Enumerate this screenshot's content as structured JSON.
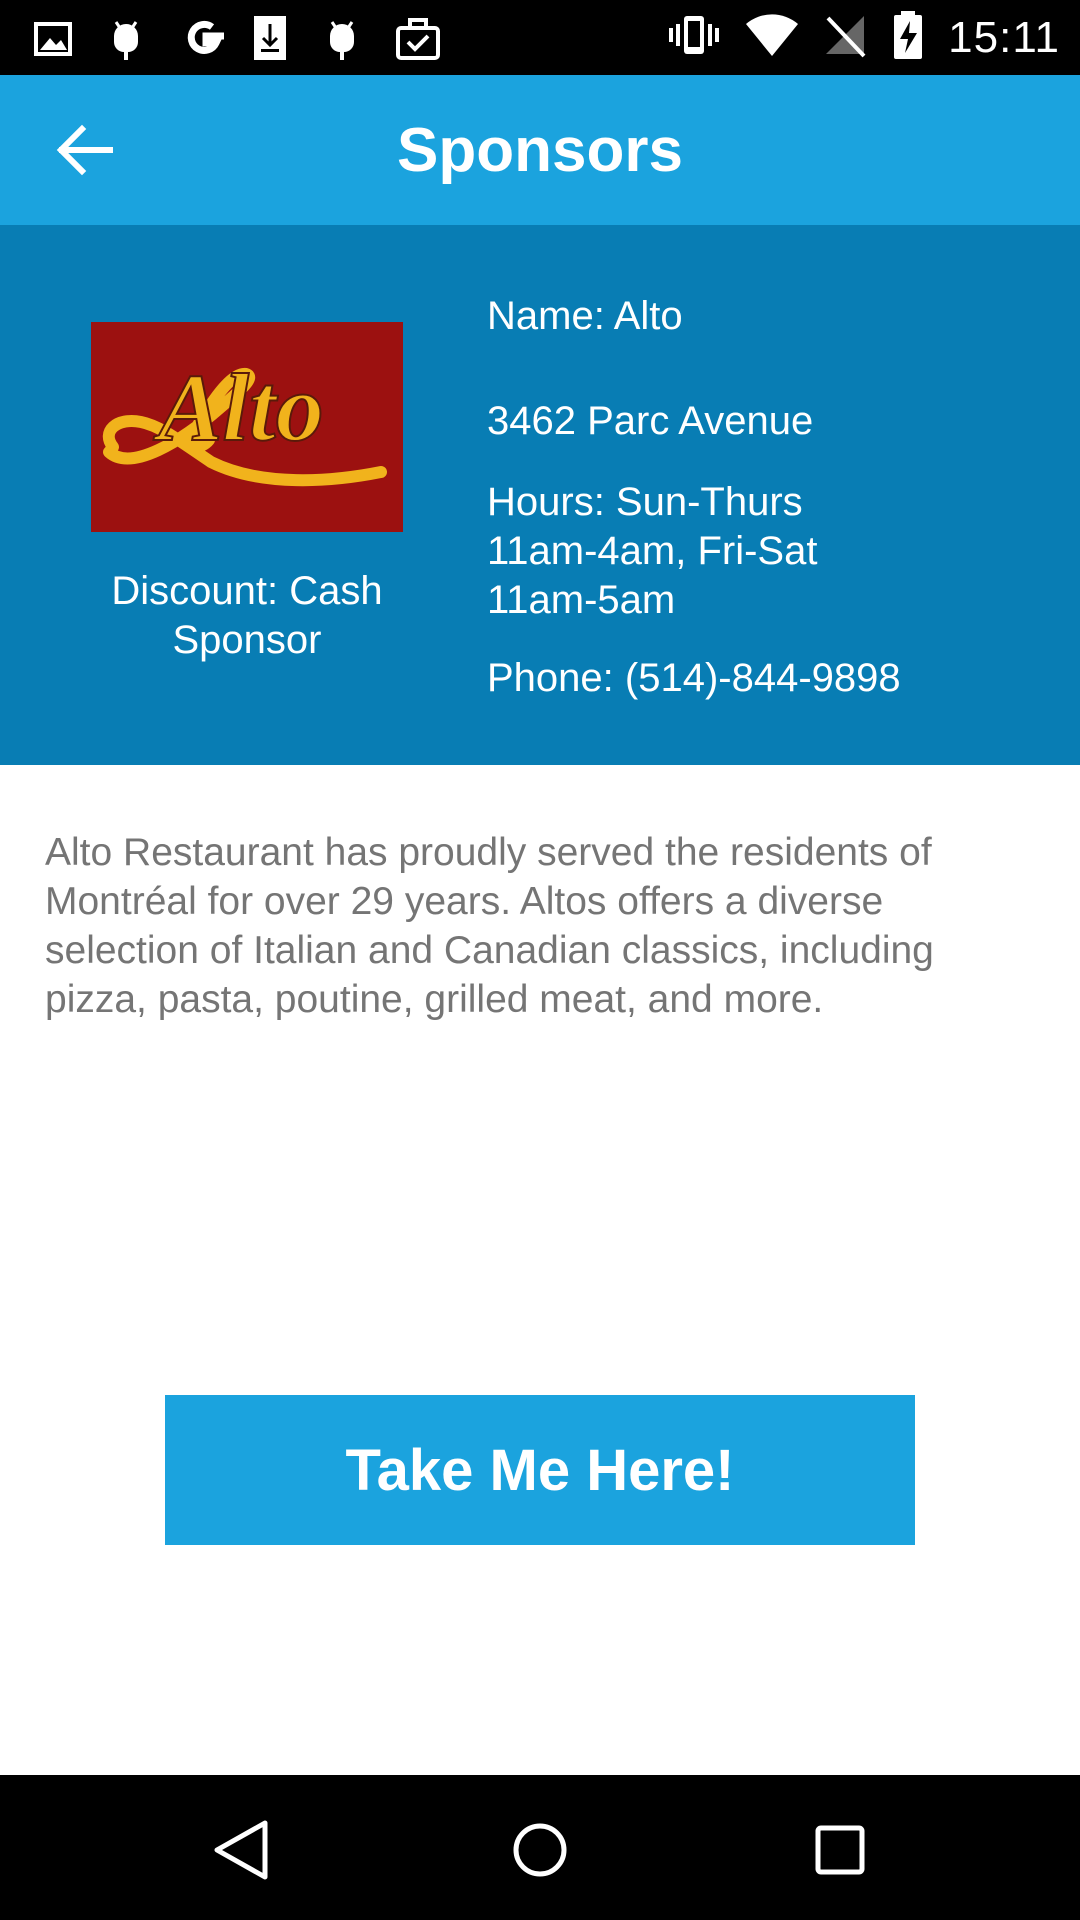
{
  "status_bar": {
    "time": "15:11",
    "left_icons": [
      "gallery-icon",
      "android-icon",
      "google-icon",
      "download-icon",
      "android-icon",
      "briefcase-check-icon"
    ],
    "right_icons": [
      "vibrate-icon",
      "wifi-icon",
      "no-signal-icon",
      "battery-charging-icon"
    ]
  },
  "app_bar": {
    "title": "Sponsors",
    "back_icon": "arrow-left-icon"
  },
  "sponsor": {
    "logo_text": "Alto",
    "discount": "Discount: Cash Sponsor",
    "name": "Name: Alto",
    "address": "3462 Parc Avenue",
    "hours": "Hours: Sun-Thurs 11am-4am, Fri-Sat 11am-5am",
    "phone": "Phone: (514)-844-9898",
    "description": "Alto Restaurant has proudly served the residents of Montréal for over 29 years. Altos offers a diverse selection of Italian and Canadian classics, including pizza, pasta, poutine, grilled meat, and more."
  },
  "cta": {
    "label": "Take Me Here!"
  },
  "nav_bar": {
    "buttons": [
      "back-triangle-icon",
      "home-circle-icon",
      "recents-square-icon"
    ]
  },
  "colors": {
    "primary": "#1ba3de",
    "panel": "#087db4",
    "logo_bg": "#9c1110",
    "logo_text": "#f1b31c",
    "body_text": "#757575"
  }
}
